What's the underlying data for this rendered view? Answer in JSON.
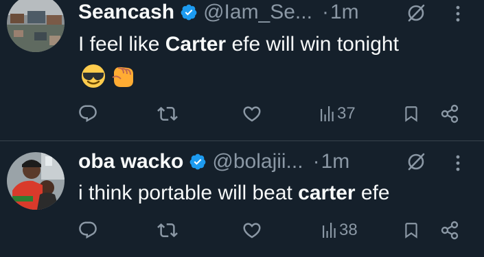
{
  "tweets": [
    {
      "name": "Seancash",
      "handle": "@Iam_Se...",
      "separator": "·",
      "time": "1m",
      "text_parts": {
        "before": "I feel like ",
        "bold": "Carter",
        "after": " efe will win tonight"
      },
      "emojis": [
        "sunglasses-emoji",
        "punch-emoji"
      ],
      "views": "37"
    },
    {
      "name": "oba wacko",
      "handle": "@bolajii...",
      "separator": "·",
      "time": "1m",
      "text_parts": {
        "before": "i think portable will beat ",
        "bold": "carter",
        "after": " efe"
      },
      "views": "38"
    }
  ],
  "colors": {
    "background": "#15202b",
    "text": "#f7f9f9",
    "muted": "#8b98a5",
    "verified": "#1d9bf0",
    "divider": "#38444d"
  }
}
